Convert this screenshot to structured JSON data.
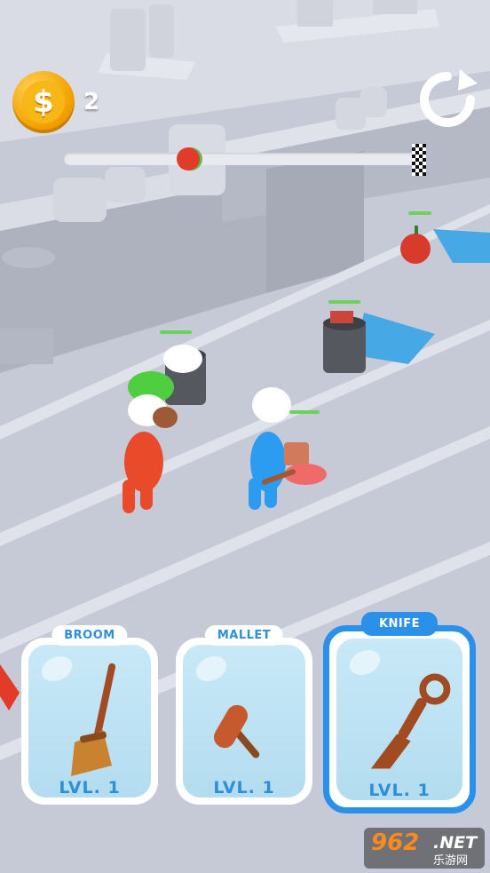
{
  "hud": {
    "coin_symbol": "$",
    "coin_count": "2",
    "level_progress": 0.35
  },
  "weapons": [
    {
      "label": "BROOM",
      "level": "LVL. 1",
      "icon": "broom-icon",
      "selected": false
    },
    {
      "label": "MALLET",
      "level": "LVL. 1",
      "icon": "mallet-icon",
      "selected": false
    },
    {
      "label": "KNIFE",
      "level": "LVL. 1",
      "icon": "knife-icon",
      "selected": true
    }
  ],
  "watermark": {
    "number": "962",
    "suffix": ".NET",
    "subtitle": "乐游网"
  },
  "colors": {
    "accent": "#2b90ea",
    "coin": "#f5a300",
    "floor": "#c9cdd8"
  }
}
